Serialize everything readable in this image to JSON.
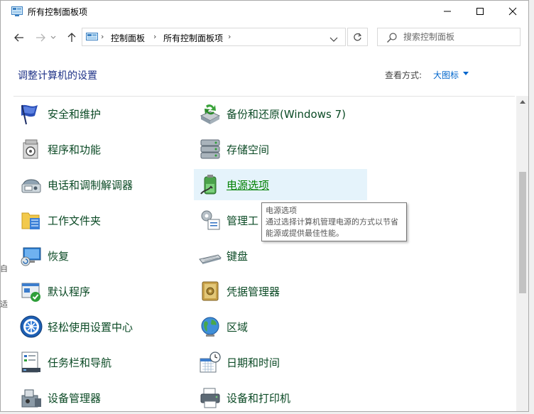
{
  "window": {
    "title": "所有控制面板项"
  },
  "breadcrumb": {
    "items": [
      "控制面板",
      "所有控制面板项"
    ]
  },
  "search": {
    "placeholder": "搜索控制面板"
  },
  "header": {
    "heading": "调整计算机的设置",
    "view_by_label": "查看方式:",
    "view_by_value": "大图标"
  },
  "items_left": [
    {
      "label": "安全和维护",
      "icon": "flag-icon"
    },
    {
      "label": "程序和功能",
      "icon": "programs-icon"
    },
    {
      "label": "电话和调制解调器",
      "icon": "phone-modem-icon"
    },
    {
      "label": "工作文件夹",
      "icon": "work-folders-icon"
    },
    {
      "label": "恢复",
      "icon": "recovery-icon"
    },
    {
      "label": "默认程序",
      "icon": "default-programs-icon"
    },
    {
      "label": "轻松使用设置中心",
      "icon": "ease-of-access-icon"
    },
    {
      "label": "任务栏和导航",
      "icon": "taskbar-icon"
    },
    {
      "label": "设备管理器",
      "icon": "device-manager-icon"
    }
  ],
  "items_right": [
    {
      "label": "备份和还原(Windows 7)",
      "icon": "backup-icon"
    },
    {
      "label": "存储空间",
      "icon": "storage-icon"
    },
    {
      "label": "电源选项",
      "icon": "power-icon"
    },
    {
      "label": "管理工",
      "icon": "admin-tools-icon"
    },
    {
      "label": "键盘",
      "icon": "keyboard-icon"
    },
    {
      "label": "凭据管理器",
      "icon": "credential-icon"
    },
    {
      "label": "区域",
      "icon": "region-icon"
    },
    {
      "label": "日期和时间",
      "icon": "datetime-icon"
    },
    {
      "label": "设备和打印机",
      "icon": "printer-icon"
    }
  ],
  "tooltip": {
    "title": "电源选项",
    "desc": "通过选择计算机管理电源的方式以节省能源或提供最佳性能。"
  },
  "side_fragments": [
    "自",
    "适"
  ],
  "colors": {
    "heading": "#1e3287",
    "item_text": "#0b4a25",
    "link": "#0066cc",
    "hover_bg": "#e5f3fb"
  }
}
